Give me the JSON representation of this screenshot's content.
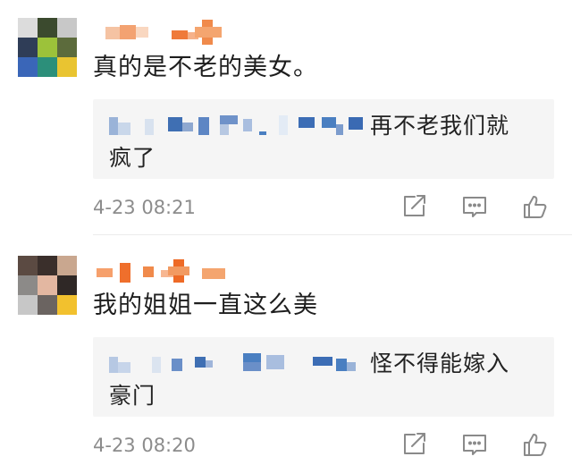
{
  "comments": [
    {
      "text": "真的是不老的美女。",
      "reply_text_line1": "再不老我们就",
      "reply_text_line2": "疯了",
      "time": "4-23 08:21",
      "icons": [
        "share-icon",
        "comment-icon",
        "like-icon"
      ]
    },
    {
      "text": "我的姐姐一直这么美",
      "reply_text_line1": "怪不得能嫁入",
      "reply_text_line2": "豪门",
      "time": "4-23 08:20",
      "icons": [
        "share-icon",
        "comment-icon",
        "like-icon"
      ]
    }
  ],
  "colors": {
    "text": "#1e1e1e",
    "reply_bg": "#f5f5f5",
    "timestamp": "#8c8c8c",
    "icon": "#8a8a8a",
    "username_mosaic": "#f08a4b",
    "reply_username_mosaic": "#4a7fc1"
  }
}
